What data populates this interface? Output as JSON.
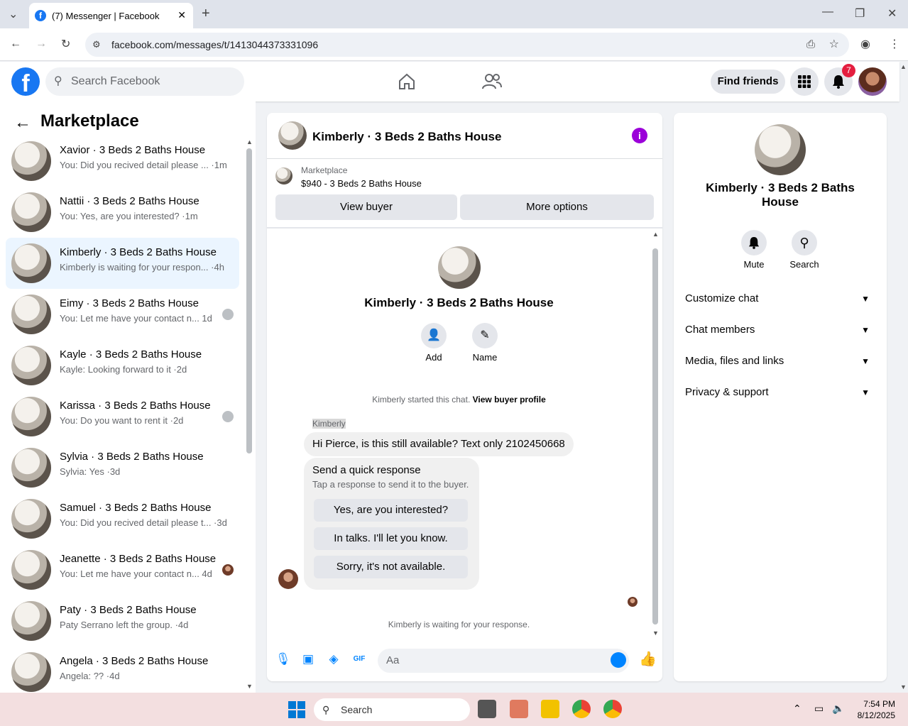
{
  "browser": {
    "tab_title": "(7) Messenger | Facebook",
    "url": "facebook.com/messages/t/1413044373331096"
  },
  "fb_header": {
    "search_placeholder": "Search Facebook",
    "find_friends": "Find friends",
    "notification_count": "7",
    "brand_color": "#1877f2"
  },
  "sidebar": {
    "title": "Marketplace",
    "conversations": [
      {
        "name": "Xavior · 3 Beds 2 Baths House",
        "preview": "You: Did you recived detail please ... ·1m",
        "active": false
      },
      {
        "name": "Nattii · 3 Beds 2 Baths House",
        "preview": "You: Yes, are you interested? ·1m",
        "active": false
      },
      {
        "name": "Kimberly · 3 Beds 2 Baths House",
        "preview": "Kimberly is waiting for your respon... ·4h",
        "active": true
      },
      {
        "name": "Eimy · 3 Beds 2 Baths House",
        "preview": "You: Let me have your contact n...   1d",
        "active": false
      },
      {
        "name": "Kayle · 3 Beds 2 Baths House",
        "preview": "Kayle: Looking forward to it ·2d",
        "active": false
      },
      {
        "name": "Karissa · 3 Beds 2 Baths House",
        "preview": "You: Do you want to rent it ·2d",
        "active": false
      },
      {
        "name": "Sylvia · 3 Beds 2 Baths House",
        "preview": "Sylvia: Yes ·3d",
        "active": false
      },
      {
        "name": "Samuel · 3 Beds 2 Baths House",
        "preview": "You: Did you recived detail please t... ·3d",
        "active": false
      },
      {
        "name": "Jeanette · 3 Beds 2 Baths House",
        "preview": "You: Let me have your contact n...   4d",
        "active": false
      },
      {
        "name": "Paty · 3 Beds 2 Baths House",
        "preview": "Paty Serrano left the group. ·4d",
        "active": false
      },
      {
        "name": "Angela · 3 Beds 2 Baths House",
        "preview": "Angela: ?? ·4d",
        "active": false
      }
    ]
  },
  "chat": {
    "title": "Kimberly · 3 Beds 2 Baths House",
    "marketplace_label": "Marketplace",
    "listing": "$940 - 3 Beds 2 Baths House",
    "view_buyer": "View buyer",
    "more_options": "More options",
    "profile_name": "Kimberly · 3 Beds 2 Baths House",
    "add_label": "Add",
    "name_label": "Name",
    "started_text": "Kimberly started this chat.",
    "view_buyer_profile": "View buyer profile",
    "sender": "Kimberly",
    "message": "Hi Pierce, is this still available? Text only 2102450668",
    "quick_title": "Send a quick response",
    "quick_sub": "Tap a response to send it to the buyer.",
    "quick_replies": [
      "Yes, are you interested?",
      "In talks. I'll let you know.",
      "Sorry, it's not available."
    ],
    "waiting": "Kimberly is waiting for your response.",
    "composer_placeholder": "Aa",
    "accent": "#0084ff"
  },
  "right_panel": {
    "name": "Kimberly · 3 Beds 2 Baths House",
    "mute": "Mute",
    "search": "Search",
    "sections": [
      "Customize chat",
      "Chat members",
      "Media, files and links",
      "Privacy & support"
    ]
  },
  "taskbar": {
    "search": "Search",
    "time": "7:54 PM",
    "date": "8/12/2025"
  }
}
